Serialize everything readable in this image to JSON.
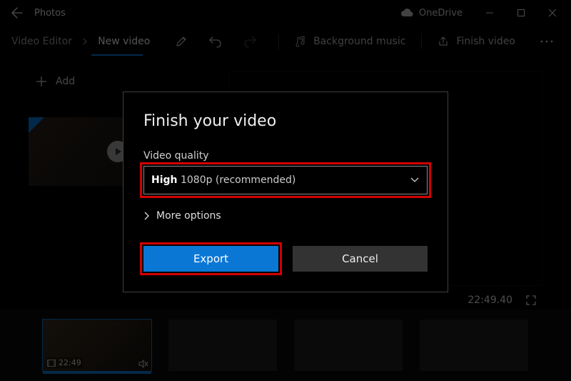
{
  "titlebar": {
    "app_name": "Photos",
    "onedrive_label": "OneDrive"
  },
  "cmdbar": {
    "crumb1": "Video Editor",
    "crumb2_active": "New video",
    "bg_music": "Background music",
    "finish_video": "Finish video"
  },
  "left_panel": {
    "add_label": "Add"
  },
  "preview": {
    "timestamp": "22:49.40"
  },
  "storyboard": {
    "items": [
      {
        "duration": "22:49"
      },
      {
        "duration": ""
      },
      {
        "duration": ""
      },
      {
        "duration": ""
      }
    ]
  },
  "dialog": {
    "title": "Finish your video",
    "quality_label": "Video quality",
    "quality_value_bold": "High",
    "quality_value_rest": " 1080p (recommended)",
    "more_options": "More options",
    "export_btn": "Export",
    "cancel_btn": "Cancel"
  }
}
